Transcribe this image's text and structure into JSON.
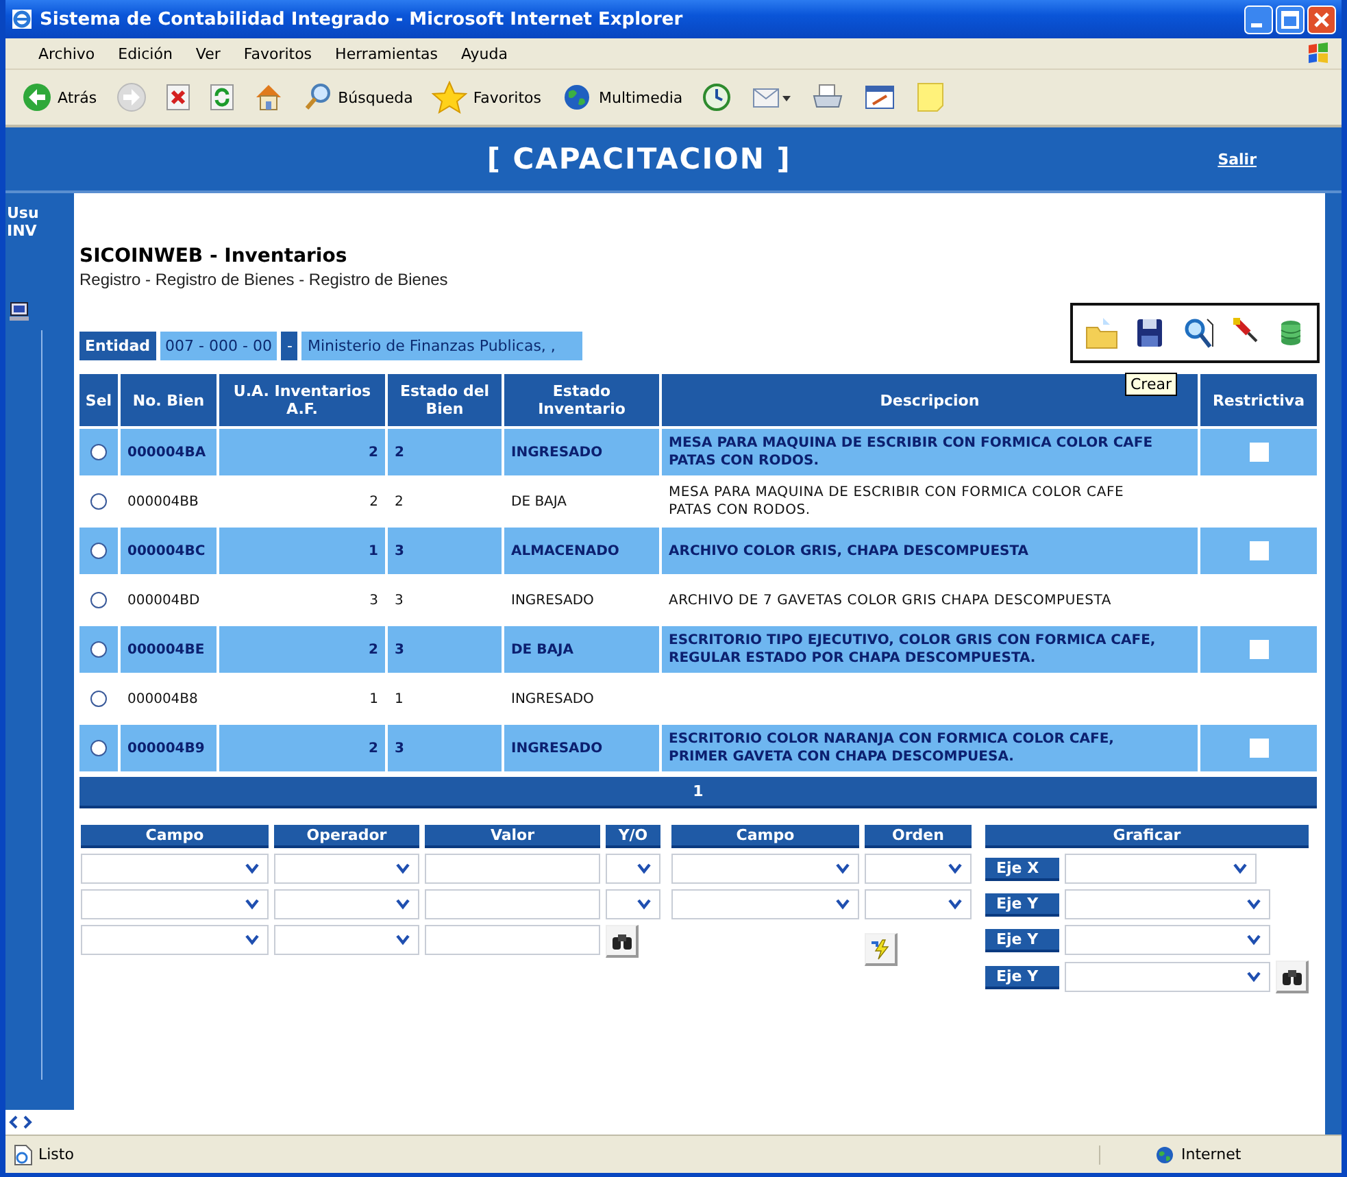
{
  "window": {
    "title": "Sistema de Contabilidad Integrado - Microsoft Internet Explorer"
  },
  "menu": [
    "Archivo",
    "Edición",
    "Ver",
    "Favoritos",
    "Herramientas",
    "Ayuda"
  ],
  "toolbar": [
    {
      "kind": "back",
      "label": "Atrás"
    },
    {
      "kind": "forward"
    },
    {
      "kind": "stop"
    },
    {
      "kind": "refresh"
    },
    {
      "kind": "home"
    },
    {
      "kind": "search",
      "label": "Búsqueda"
    },
    {
      "kind": "favorites",
      "label": "Favoritos"
    },
    {
      "kind": "media",
      "label": "Multimedia"
    },
    {
      "kind": "history"
    },
    {
      "kind": "mail"
    },
    {
      "kind": "print"
    },
    {
      "kind": "edit"
    },
    {
      "kind": "note"
    }
  ],
  "sidebar": {
    "texts": [
      "Usu",
      "INV"
    ]
  },
  "header": {
    "title": "[ CAPACITACION ]",
    "logout": "Salir"
  },
  "module": {
    "title": "SICOINWEB - Inventarios",
    "breadcrumb": "Registro - Registro de Bienes - Registro de Bienes"
  },
  "entity": {
    "label": "Entidad",
    "code": "007 - 000 - 00",
    "separator": "-",
    "name": "Ministerio de Finanzas Publicas, ,"
  },
  "actions": [
    {
      "kind": "create"
    },
    {
      "kind": "save"
    },
    {
      "kind": "search"
    },
    {
      "kind": "clear"
    },
    {
      "kind": "database"
    }
  ],
  "tooltip": "Crear",
  "table": {
    "columns": [
      "Sel",
      "No. Bien",
      "U.A. Inventarios A.F.",
      "Estado del Bien",
      "Estado Inventario",
      "Descripcion",
      "Restrictiva"
    ],
    "rows": [
      {
        "highlighted": true,
        "selected": false,
        "no_bien": "000004BA",
        "ua": "2",
        "estado_bien": "2",
        "estado_inventario": "INGRESADO",
        "descripcion": "MESA PARA MAQUINA DE ESCRIBIR CON FORMICA COLOR CAFE PATAS CON RODOS.",
        "restrictiva": {
          "checked": false
        }
      },
      {
        "highlighted": false,
        "selected": false,
        "no_bien": "000004BB",
        "ua": "2",
        "estado_bien": "2",
        "estado_inventario": "DE BAJA",
        "descripcion": "MESA PARA MAQUINA DE ESCRIBIR CON FORMICA COLOR CAFE PATAS CON RODOS."
      },
      {
        "highlighted": true,
        "selected": false,
        "no_bien": "000004BC",
        "ua": "1",
        "estado_bien": "3",
        "estado_inventario": "ALMACENADO",
        "descripcion": "ARCHIVO COLOR GRIS, CHAPA DESCOMPUESTA",
        "restrictiva": {
          "checked": false
        }
      },
      {
        "highlighted": false,
        "selected": false,
        "no_bien": "000004BD",
        "ua": "3",
        "estado_bien": "3",
        "estado_inventario": "INGRESADO",
        "descripcion": "ARCHIVO DE 7 GAVETAS COLOR GRIS CHAPA DESCOMPUESTA"
      },
      {
        "highlighted": true,
        "selected": false,
        "no_bien": "000004BE",
        "ua": "2",
        "estado_bien": "3",
        "estado_inventario": "DE BAJA",
        "descripcion": "ESCRITORIO TIPO EJECUTIVO, COLOR GRIS CON FORMICA CAFE, REGULAR ESTADO POR CHAPA DESCOMPUESTA.",
        "restrictiva": {
          "checked": false
        }
      },
      {
        "highlighted": false,
        "selected": false,
        "no_bien": "000004B8",
        "ua": "1",
        "estado_bien": "1",
        "estado_inventario": "INGRESADO"
      },
      {
        "highlighted": true,
        "selected": false,
        "no_bien": "000004B9",
        "ua": "2",
        "estado_bien": "3",
        "estado_inventario": "INGRESADO",
        "descripcion": "ESCRITORIO COLOR NARANJA CON FORMICA COLOR CAFE, PRIMER GAVETA CON CHAPA DESCOMPUESA.",
        "restrictiva": {
          "checked": false
        }
      }
    ]
  },
  "pager": {
    "page": "1"
  },
  "conditions": {
    "columns": [
      "Campo",
      "Operador",
      "Valor",
      "Y/O"
    ],
    "rows": [
      [
        {
          "kind": "select"
        },
        {
          "kind": "select"
        },
        {
          "kind": "input"
        },
        {
          "kind": "select"
        }
      ],
      [
        {
          "kind": "select"
        },
        {
          "kind": "select"
        },
        {
          "kind": "input"
        },
        {
          "kind": "select"
        }
      ],
      [
        {
          "kind": "select"
        },
        {
          "kind": "select"
        },
        {
          "kind": "input"
        }
      ]
    ]
  },
  "sort": {
    "columns": [
      "Campo",
      "Orden"
    ],
    "rows": [
      [
        {
          "kind": "select"
        },
        {
          "kind": "select"
        }
      ],
      [
        {
          "kind": "select"
        },
        {
          "kind": "select"
        }
      ]
    ]
  },
  "chart": {
    "title": "Graficar",
    "axes": [
      "Eje X",
      "Eje Y",
      "Eje Y",
      "Eje Y"
    ]
  },
  "status_bar": {
    "text": "Listo",
    "zone": "Internet"
  }
}
